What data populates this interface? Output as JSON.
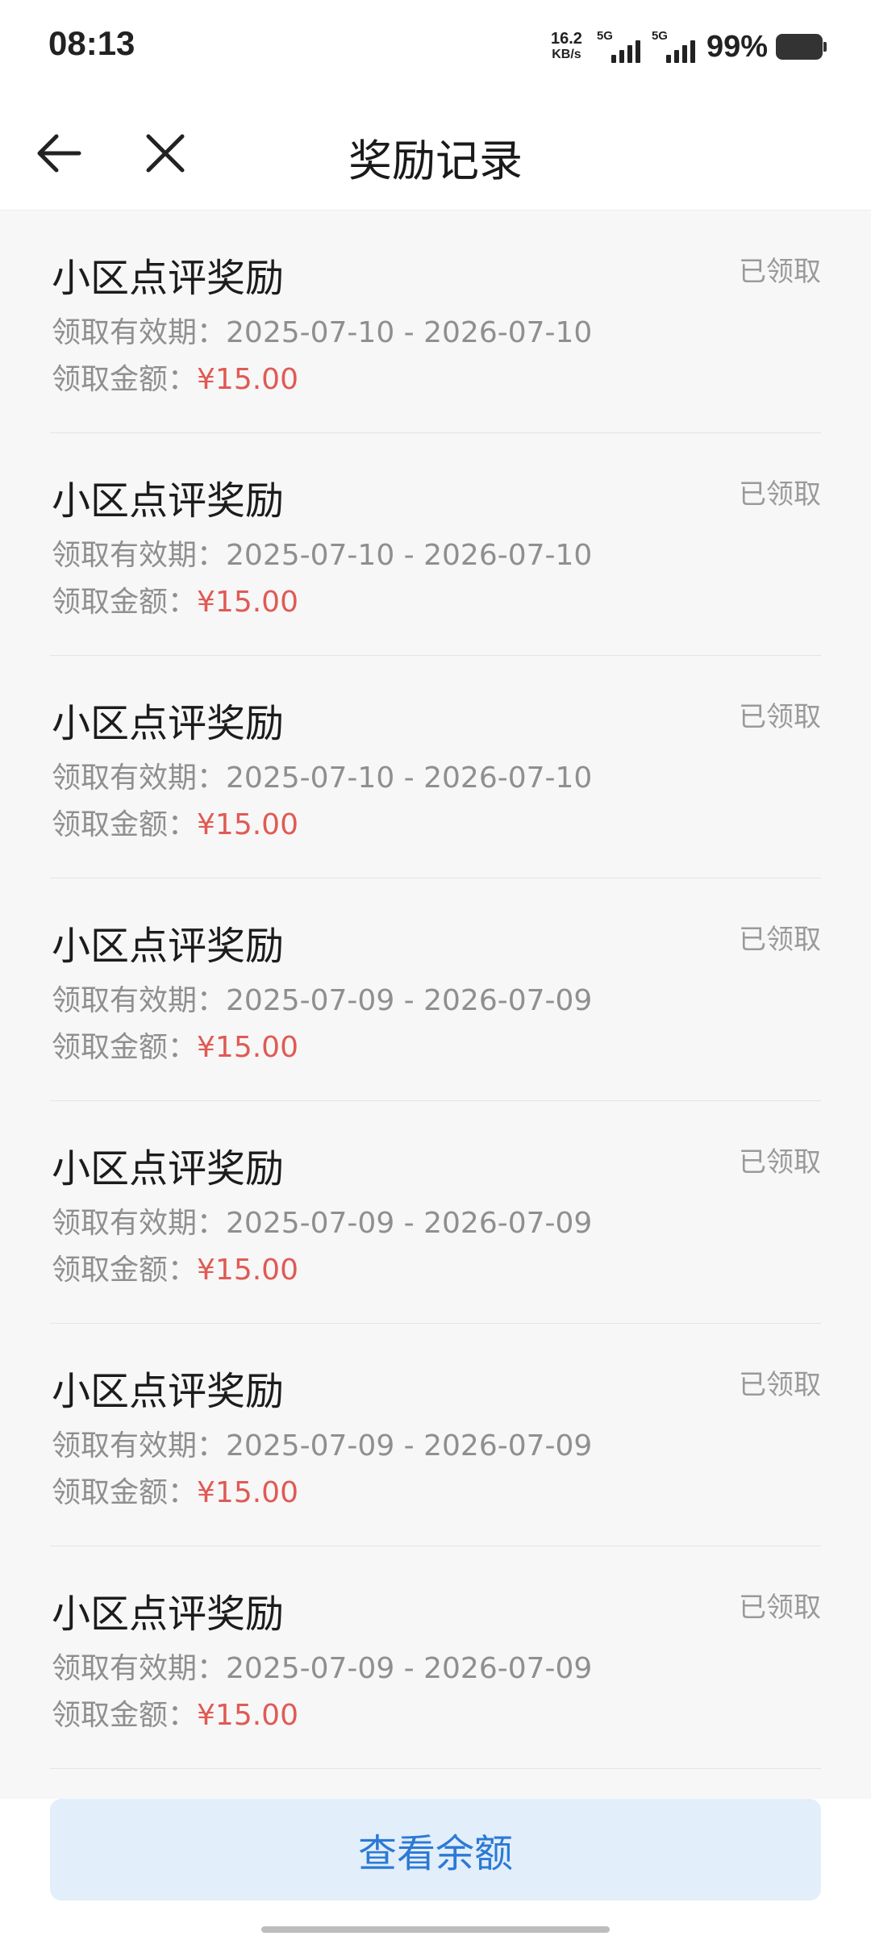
{
  "status_bar": {
    "time": "08:13",
    "net_speed_value": "16.2",
    "net_speed_unit": "KB/s",
    "sim1_label": "5G",
    "sim2_label": "5G",
    "battery_percent": "99%"
  },
  "nav": {
    "title": "奖励记录",
    "back_icon": "arrow-left-icon",
    "close_icon": "close-icon"
  },
  "records": [
    {
      "title": "小区点评奖励",
      "status": "已领取",
      "period_label": "领取有效期：",
      "period": "2025-07-10 - 2026-07-10",
      "amount_label": "领取金额：",
      "amount": "¥15.00"
    },
    {
      "title": "小区点评奖励",
      "status": "已领取",
      "period_label": "领取有效期：",
      "period": "2025-07-10 - 2026-07-10",
      "amount_label": "领取金额：",
      "amount": "¥15.00"
    },
    {
      "title": "小区点评奖励",
      "status": "已领取",
      "period_label": "领取有效期：",
      "period": "2025-07-10 - 2026-07-10",
      "amount_label": "领取金额：",
      "amount": "¥15.00"
    },
    {
      "title": "小区点评奖励",
      "status": "已领取",
      "period_label": "领取有效期：",
      "period": "2025-07-09 - 2026-07-09",
      "amount_label": "领取金额：",
      "amount": "¥15.00"
    },
    {
      "title": "小区点评奖励",
      "status": "已领取",
      "period_label": "领取有效期：",
      "period": "2025-07-09 - 2026-07-09",
      "amount_label": "领取金额：",
      "amount": "¥15.00"
    },
    {
      "title": "小区点评奖励",
      "status": "已领取",
      "period_label": "领取有效期：",
      "period": "2025-07-09 - 2026-07-09",
      "amount_label": "领取金额：",
      "amount": "¥15.00"
    },
    {
      "title": "小区点评奖励",
      "status": "已领取",
      "period_label": "领取有效期：",
      "period": "2025-07-09 - 2026-07-09",
      "amount_label": "领取金额：",
      "amount": "¥15.00"
    }
  ],
  "bottom": {
    "balance_button_label": "查看余额"
  },
  "colors": {
    "amount": "#e05a55",
    "button_bg": "#e3eefb",
    "button_text": "#2a7ad5"
  }
}
